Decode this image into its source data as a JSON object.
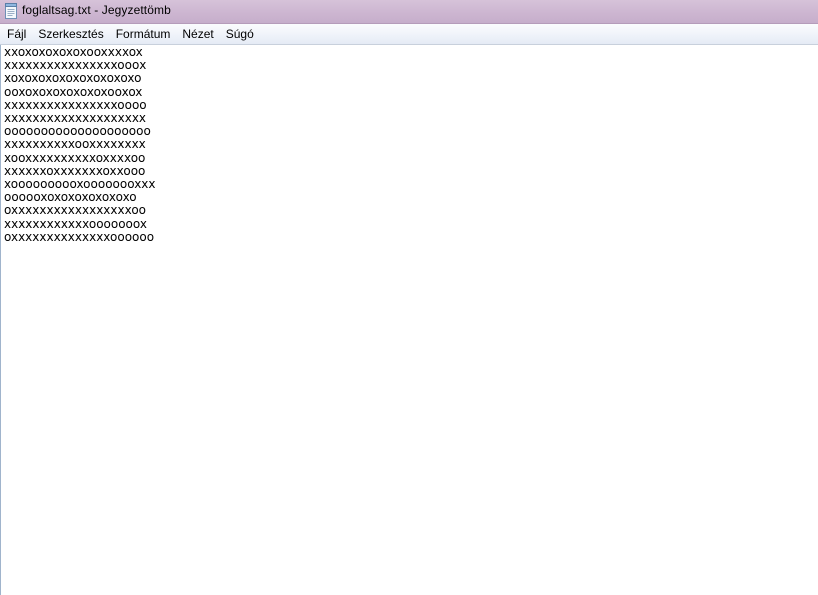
{
  "window": {
    "title": "foglaltsag.txt - Jegyzettömb",
    "icon": "notepad-icon"
  },
  "menu": {
    "items": [
      {
        "label": "Fájl"
      },
      {
        "label": "Szerkesztés"
      },
      {
        "label": "Formátum"
      },
      {
        "label": "Nézet"
      },
      {
        "label": "Súgó"
      }
    ]
  },
  "editor": {
    "content": "xxoxoxoxoxoxooxxxxox\nxxxxxxxxxxxxxxxxoooх\nxoxoxoxoxoxoxoxoxoxo\nooxoxoxoxoxoxoxooxox\nxxxxxxxxxxxxxxxxoooo\nxxxxxxxxxxxxxxxxxxxx\noooooooooooooooooooo\nxxxxxxxxxxooxxxxxxxx\nxooxxxxxxxxxxoxxxxoo\nxxxxxxoxxxxxxxoxxooo\nxoooooooooxoooooooxxx\noooooxoxoxoxoxoxoxo\noxxxxxxxxxxxxxxxxxoo\nxxxxxxxxxxxxooooooox\noxxxxxxxxxxxxxxoooooo"
  },
  "colors": {
    "titlebar": "#cdb6d1",
    "menubar": "#eef2f9",
    "editor_background": "#ffffff"
  }
}
